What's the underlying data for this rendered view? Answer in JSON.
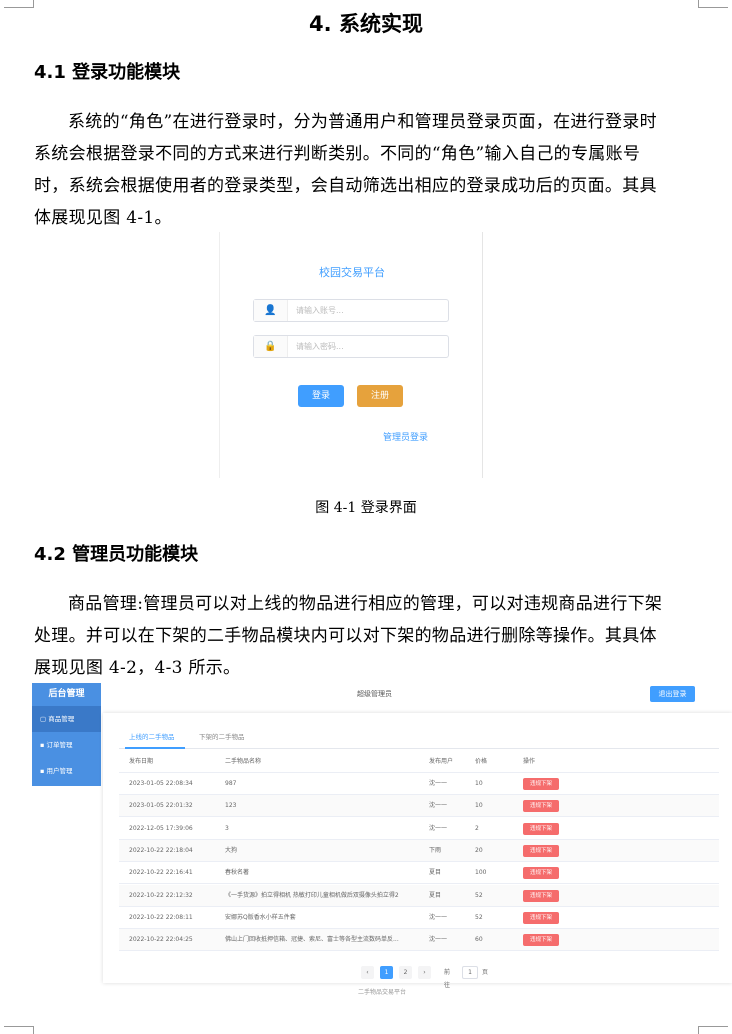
{
  "heading": "4.  系统实现",
  "section1": {
    "title": "4.1  登录功能模块",
    "paragraph": "系统的“角色”在进行登录时，分为普通用户和管理员登录页面，在进行登录时系统会根据登录不同的方式来进行判断类别。不同的“角色”输入自己的专属账号时，系统会根据使用者的登录类型，会自动筛选出相应的登录成功后的页面。其具体展现见图 4-1。"
  },
  "login": {
    "title": "校园交易平台",
    "account_placeholder": "请输入账号...",
    "password_placeholder": "请输入密码...",
    "login_btn": "登录",
    "register_btn": "注册",
    "admin_link": "管理员登录",
    "user_icon": "user-icon",
    "lock_icon": "lock-icon"
  },
  "caption1": "图 4-1  登录界面",
  "section2": {
    "title": "4.2  管理员功能模块",
    "paragraph": "商品管理:管理员可以对上线的物品进行相应的管理，可以对违规商品进行下架处理。并可以在下架的二手物品模块内可以对下架的物品进行删除等操作。其具体展现见图 4-2，4-3 所示。"
  },
  "admin": {
    "sidebar_title": "后台管理",
    "menu": [
      "商品管理",
      "订单管理",
      "用户管理"
    ],
    "top_title": "超级管理员",
    "logout": "退出登录",
    "tabs": [
      "上线的二手物品",
      "下架的二手物品"
    ],
    "headers": [
      "发布日期",
      "二手物品名称",
      "发布用户",
      "价格",
      "操作"
    ],
    "rows": [
      {
        "date": "2023-01-05 22:08:34",
        "name": "987",
        "user": "沈一一",
        "price": "10",
        "action": "违规下架"
      },
      {
        "date": "2023-01-05 22:01:32",
        "name": "123",
        "user": "沈一一",
        "price": "10",
        "action": "违规下架"
      },
      {
        "date": "2022-12-05 17:39:06",
        "name": "3",
        "user": "沈一一",
        "price": "2",
        "action": "违规下架"
      },
      {
        "date": "2022-10-22 22:18:04",
        "name": "大狗",
        "user": "下雨",
        "price": "20",
        "action": "违规下架"
      },
      {
        "date": "2022-10-22 22:16:41",
        "name": "春秋名著",
        "user": "夏目",
        "price": "100",
        "action": "违规下架"
      },
      {
        "date": "2022-10-22 22:12:32",
        "name": "《一手货源》拍立得相机 热敏打印儿童相机做后双摄像头拍立得2",
        "user": "夏目",
        "price": "52",
        "action": "违规下架"
      },
      {
        "date": "2022-10-22 22:08:11",
        "name": "安娜苏Q版香水小样五件套",
        "user": "沈一一",
        "price": "52",
        "action": "违规下架"
      },
      {
        "date": "2022-10-22 22:04:25",
        "name": "佛山上门回收抵押信箱、冠捷、索尼、富士等各型主流数码单反...",
        "user": "沈一一",
        "price": "60",
        "action": "违规下架"
      }
    ],
    "pager": {
      "prev": "‹",
      "pages": [
        "1",
        "2"
      ],
      "next": "›",
      "goto": "前往",
      "page_value": "1",
      "page_unit": "页"
    },
    "footer": "二手物品交易平台"
  }
}
